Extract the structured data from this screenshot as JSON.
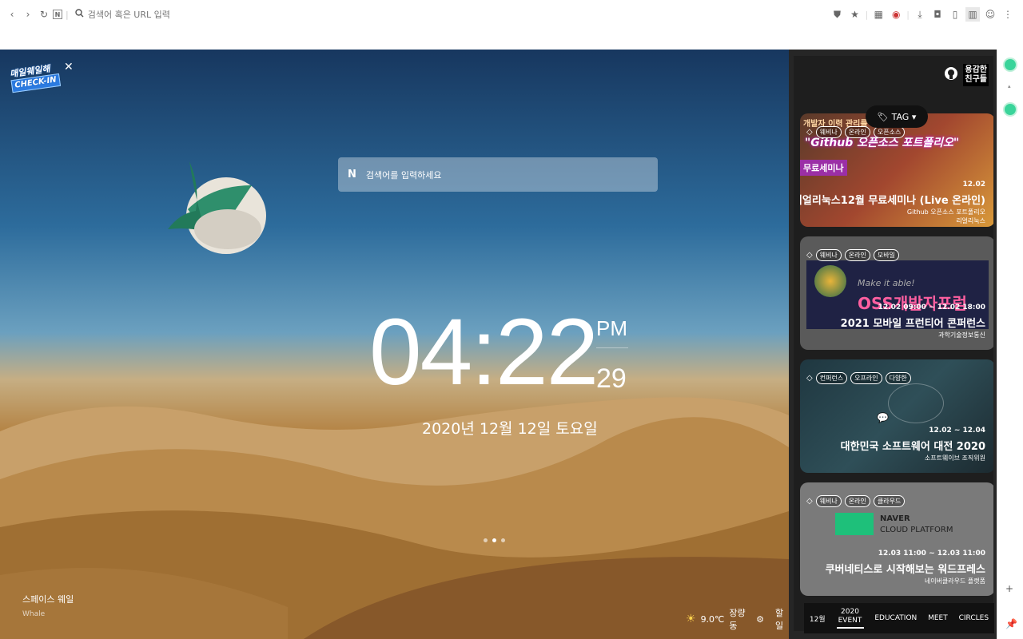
{
  "browser": {
    "address_placeholder": "검색어 혹은 URL 입력"
  },
  "stage": {
    "checkin_line1": "매일웨일해",
    "checkin_line2": "CHECK-IN",
    "search_brand": "N",
    "search_placeholder": "검색어를 입력하세요",
    "time": "04:22",
    "ampm": "PM",
    "seconds": "29",
    "date": "2020년 12월 12일 토요일",
    "credit_title": "스페이스 웨일",
    "credit_sub": "Whale",
    "weather_temp": "9.0℃",
    "weather_loc": "장량동",
    "trailing_text": "할 일"
  },
  "sidebar": {
    "title_line1": "용감한",
    "title_line2": "친구들",
    "tag_button": "TAG ▾",
    "cards": [
      {
        "tags": [
          "웨비나",
          "온라인",
          "오픈소스"
        ],
        "date": "12.02",
        "title": "리얼리눅스12월 무료세미나 (Live 온라인)",
        "org1": "Github 오픈소스 포트폴리오",
        "org2": "리얼리눅스",
        "art1": "개발자 이력 관리를 위한",
        "art2": "\"Github 오픈소스 포트폴리오\"",
        "art3": "무료세미나"
      },
      {
        "tags": [
          "웨비나",
          "온라인",
          "모바일"
        ],
        "date": "12.02 09:00 ~ 12.02 18:00",
        "title": "2021 모바일 프런티어 콘퍼런스",
        "org1": "과학기술정보통신",
        "org2": "",
        "art1": "Make it able!",
        "art2": "OSS개발자포럼"
      },
      {
        "tags": [
          "컨퍼런스",
          "오프라인",
          "다양한"
        ],
        "date": "12.02 ~ 12.04",
        "title": "대한민국 소프트웨어 대전 2020",
        "org1": "소프트웨이브 조직위원",
        "org2": ""
      },
      {
        "tags": [
          "웨비나",
          "온라인",
          "클라우드"
        ],
        "date": "12.03 11:00 ~ 12.03 11:00",
        "title": "쿠버네티스로 시작해보는 워드프레스",
        "org1": "네이버클라우드 플랫폼",
        "org2": "",
        "art1": "NAVER",
        "art2": "CLOUD PLATFORM"
      }
    ],
    "bottom_nav": [
      "12월",
      "2020 EVENT",
      "EDUCATION",
      "MEET",
      "CIRCLES"
    ]
  },
  "colors": {
    "accent_green": "#3ad49a",
    "sky_top": "#17375f",
    "sand": "#b27e3c"
  }
}
